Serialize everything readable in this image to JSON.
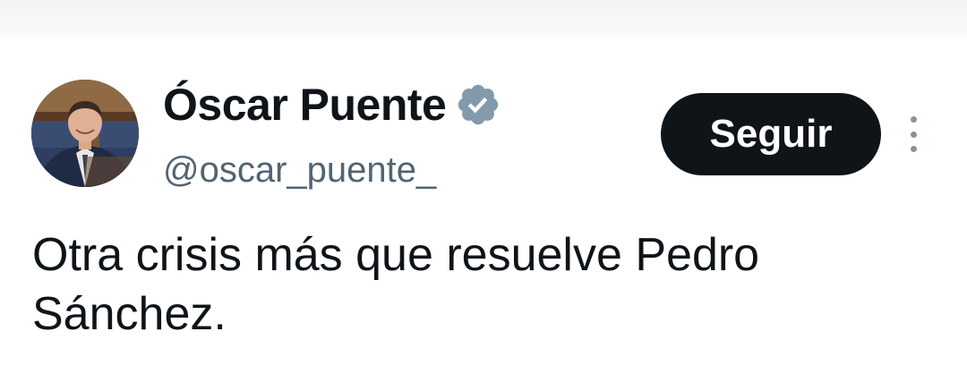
{
  "tweet": {
    "author": {
      "display_name": "Óscar Puente",
      "handle": "@oscar_puente_",
      "verified": true,
      "avatar_icon": "profile-photo"
    },
    "follow_label": "Seguir",
    "more_icon": "more-vertical-icon",
    "text": "Otra crisis más que resuelve Pedro Sánchez."
  },
  "colors": {
    "text_primary": "#0f1419",
    "text_secondary": "#536471",
    "verified_badge": "#829aab",
    "button_bg": "#0f1419",
    "button_text": "#ffffff"
  }
}
